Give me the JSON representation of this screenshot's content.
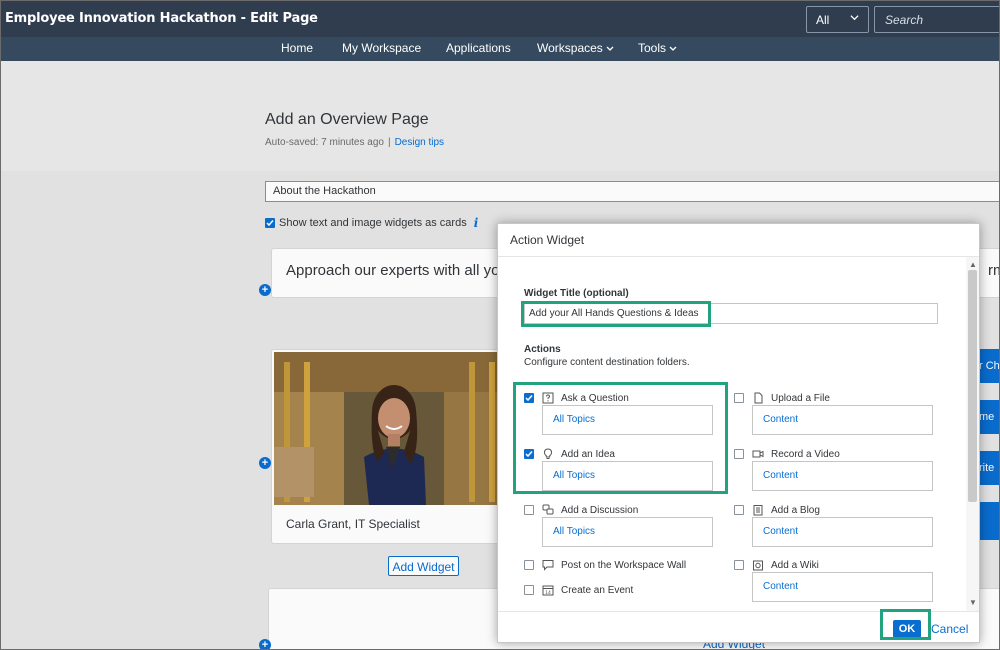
{
  "header": {
    "title": "Employee Innovation Hackathon - Edit Page",
    "scope_value": "All",
    "search_placeholder": "Search"
  },
  "nav": {
    "items": [
      {
        "label": "Home"
      },
      {
        "label": "My Workspace"
      },
      {
        "label": "Applications"
      },
      {
        "label": "Workspaces",
        "has_menu": true
      },
      {
        "label": "Tools",
        "has_menu": true
      }
    ]
  },
  "page": {
    "title": "Add an Overview Page",
    "autosaved": "Auto-saved: 7 minutes ago",
    "separator": "|",
    "design_tips": "Design tips",
    "section_title_value": "About the Hackathon",
    "cards_checkbox_label": "Show text and image widgets as cards",
    "cards_checkbox_checked": true,
    "text_card": "Approach our experts with all yo",
    "text_card_tail": "rma",
    "photo_caption": "Carla Grant, IT Specialist",
    "add_widget": "Add Widget",
    "add_widget_lower": "Add Widget",
    "side_tabs": [
      "r Ch",
      "me",
      "rite"
    ]
  },
  "dialog": {
    "title": "Action Widget",
    "widget_title_label": "Widget Title (optional)",
    "widget_title_value": "Add your All Hands Questions & Ideas",
    "actions_label": "Actions",
    "actions_sub": "Configure content destination folders.",
    "left_actions": [
      {
        "label": "Ask a Question",
        "checked": true,
        "icon": "question-icon",
        "dest": "All Topics"
      },
      {
        "label": "Add an Idea",
        "checked": true,
        "icon": "lightbulb-icon",
        "dest": "All Topics"
      },
      {
        "label": "Add a Discussion",
        "checked": false,
        "icon": "discussion-icon",
        "dest": "All Topics"
      },
      {
        "label": "Post on the Workspace Wall",
        "checked": false,
        "icon": "comment-icon",
        "dest": ""
      },
      {
        "label": "Create an Event",
        "checked": false,
        "icon": "calendar-icon",
        "dest": ""
      }
    ],
    "right_actions": [
      {
        "label": "Upload a File",
        "checked": false,
        "icon": "file-icon",
        "dest": "Content"
      },
      {
        "label": "Record a Video",
        "checked": false,
        "icon": "video-icon",
        "dest": "Content"
      },
      {
        "label": "Add a Blog",
        "checked": false,
        "icon": "blog-icon",
        "dest": "Content"
      },
      {
        "label": "Add a Wiki",
        "checked": false,
        "icon": "wiki-icon",
        "dest": "Content"
      }
    ],
    "ok": "OK",
    "cancel": "Cancel"
  },
  "colors": {
    "topbar": "#2f3d4e",
    "navbar": "#354a5f",
    "accent": "#0a6ed1",
    "highlight": "#21a37f"
  }
}
